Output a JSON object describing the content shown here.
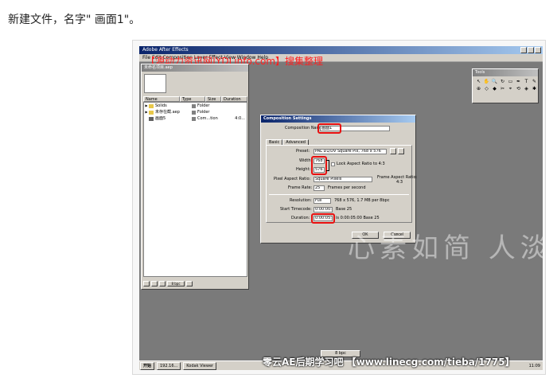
{
  "caption": "新建文件，名字\" 画面1\"。",
  "ae": {
    "app_title": "Adobe After Effects",
    "menu": "File  Edit  Composition  Layer  Effect  View  Window  Help"
  },
  "watermarks": {
    "top": "【源动力资讯网|YDLinfo.com】搜集整理",
    "middle": "心素如简  人淡如菊",
    "bottom": "零云AE后期学习吧 【www.linecg.com/tieba/1775】"
  },
  "project": {
    "title": "未命名项目.aep",
    "columns": [
      "Name",
      "Type",
      "Size",
      "Duration"
    ],
    "items": [
      {
        "name": "Solids",
        "type": "Folder",
        "duration": ""
      },
      {
        "name": "未存在截.aep",
        "type": "Folder",
        "duration": ""
      },
      {
        "name": "画面5",
        "type": "Com...tion",
        "duration": "4:0..."
      }
    ],
    "bpc": "8 bpc"
  },
  "tools": {
    "title": "Tools",
    "icons": [
      "↖",
      "✋",
      "🔍",
      "↻",
      "▭",
      "✒",
      "T",
      "✎",
      "⊕",
      "◇",
      "◆",
      "✂",
      "⌖",
      "⟲",
      "◈",
      "✱"
    ]
  },
  "dialog": {
    "title": "Composition Settings",
    "composition_name_label": "Composition Name:",
    "composition_name": "画面1",
    "tabs": [
      "Basic",
      "Advanced"
    ],
    "preset_label": "Preset:",
    "preset": "PAL D1/DV Square Pix, 768 x 576",
    "width_label": "Width:",
    "width": "768",
    "height_label": "Height:",
    "height": "576",
    "lock_label": "Lock Aspect Ratio to 4:3",
    "par_label": "Pixel Aspect Ratio:",
    "par": "Square Pixels",
    "frame_aspect_label": "Frame Aspect Ratio:",
    "frame_aspect": "4:3",
    "frame_rate_label": "Frame Rate:",
    "frame_rate": "25",
    "frame_rate_unit": "Frames per second",
    "resolution_label": "Resolution:",
    "resolution": "Full",
    "resolution_info": "768 x 576, 1.7 MB per 8bpc",
    "start_tc_label": "Start Timecode:",
    "start_tc": "0:00:00:00",
    "start_tc_base": "Base 25",
    "duration_label": "Duration:",
    "duration": "0:00:05:00",
    "duration_info": "is 0:00:05:00  Base 25",
    "ok": "OK",
    "cancel": "Cancel"
  },
  "bottom": {
    "mini_bar": "8 bpc",
    "start": "开始",
    "tasks": [
      "192.16...",
      "Kodak Viewer"
    ],
    "clock": "11:09"
  },
  "colors": {
    "highlight": "#e81010",
    "desktop": "#7a7a7a",
    "chrome": "#d4d0c8",
    "title_bar": "#0a246a"
  }
}
